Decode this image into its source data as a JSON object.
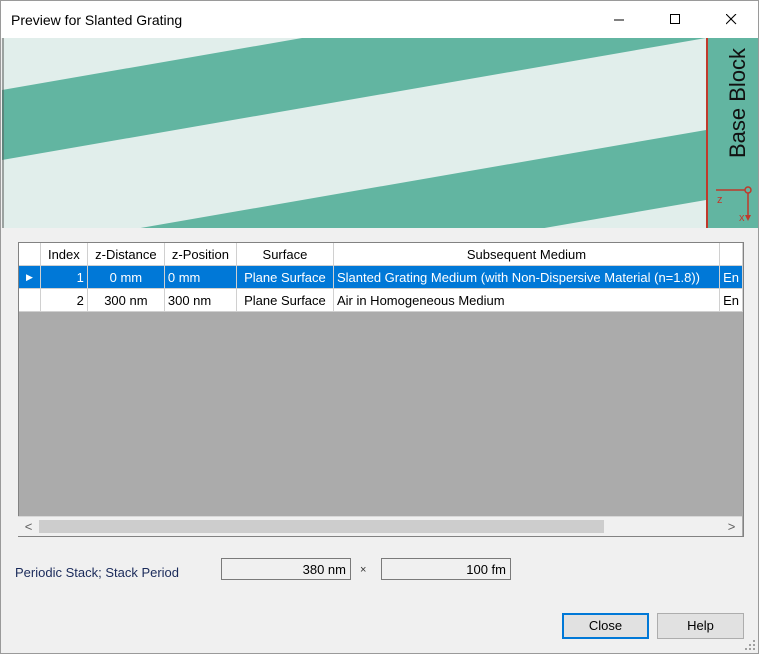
{
  "window": {
    "title": "Preview for Slanted Grating",
    "minimize_glyph": "—",
    "maximize_glyph": "☐",
    "close_glyph": "✕"
  },
  "preview": {
    "base_block_label": "Base Block",
    "axis_z": "z",
    "axis_x": "x",
    "colors": {
      "background": "#e1eeeb",
      "stripe": "#62b5a1",
      "border": "#c0392b"
    }
  },
  "table": {
    "columns": [
      "Index",
      "z-Distance",
      "z-Position",
      "Surface",
      "Subsequent Medium",
      ""
    ],
    "rows": [
      {
        "marker": "▶",
        "index": "1",
        "z_distance": "0 mm",
        "z_position": "0 mm",
        "surface": "Plane Surface",
        "medium": "Slanted Grating Medium (with Non-Dispersive Material (n=1.8))",
        "extra": "En",
        "selected": true
      },
      {
        "marker": "",
        "index": "2",
        "z_distance": "300 nm",
        "z_position": "300 nm",
        "surface": "Plane Surface",
        "medium": "Air in Homogeneous Medium",
        "extra": "En",
        "selected": false
      }
    ],
    "scroll_left_glyph": "<",
    "scroll_right_glyph": ">"
  },
  "stack": {
    "label": "Periodic Stack; Stack Period",
    "period_value": "380 nm",
    "times_symbol": "×",
    "count_value": "100 fm"
  },
  "buttons": {
    "close": "Close",
    "help": "Help"
  }
}
